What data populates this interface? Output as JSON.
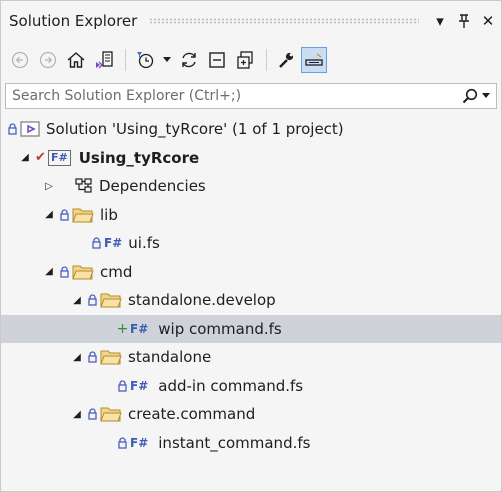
{
  "window": {
    "title": "Solution Explorer"
  },
  "search": {
    "placeholder": "Search Solution Explorer (Ctrl+;)"
  },
  "colors": {
    "folder": "#dcb67a",
    "lock": "#4d5fc0",
    "selected_row": "#cfd3d9",
    "active_tool": "#c9def5"
  },
  "tree": {
    "solution": "Solution 'Using_tyRcore' (1 of 1 project)",
    "project": "Using_tyRcore",
    "fs_badge": "F#",
    "items": {
      "dependencies": "Dependencies",
      "lib": "lib",
      "ui_fs": "ui.fs",
      "cmd": "cmd",
      "standalone_develop": "standalone.develop",
      "wip_command": "wip command.fs",
      "standalone": "standalone",
      "addin_command": "add-in command.fs",
      "create_command": "create.command",
      "instant_command": "instant_command.fs"
    }
  },
  "toolbar_icons": [
    "back-icon",
    "forward-icon",
    "home-icon",
    "switch-views-icon",
    "pending-changes-filter-icon",
    "dropdown-arrow-icon",
    "sync-icon",
    "collapse-all-icon",
    "show-all-files-icon",
    "properties-wrench-icon",
    "preview-selected-items-icon"
  ]
}
